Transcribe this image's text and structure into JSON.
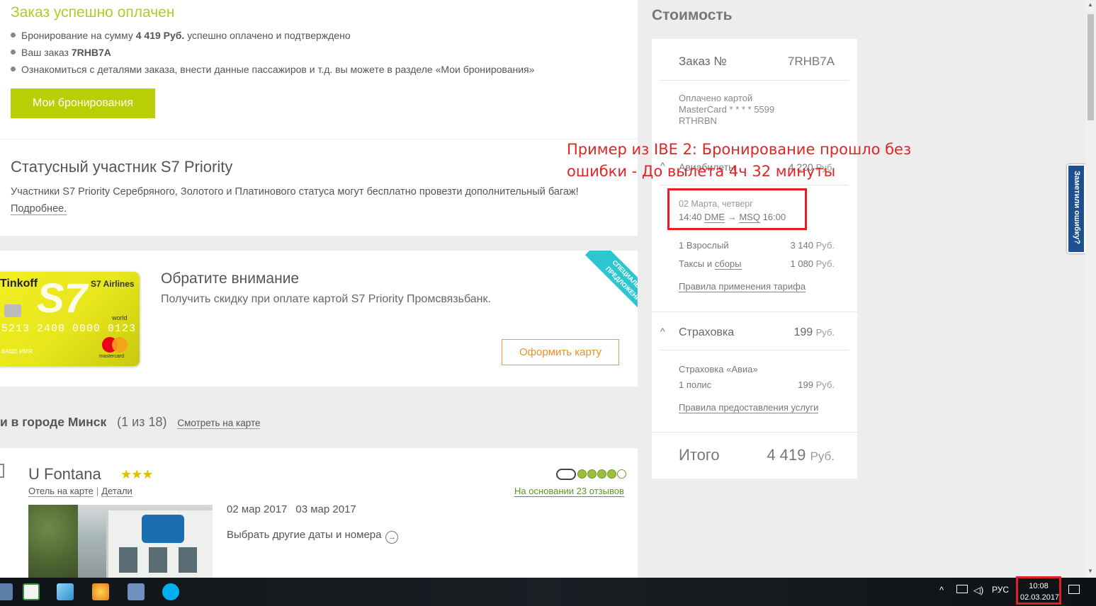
{
  "success": {
    "title": "Заказ успешно оплачен",
    "line1_pre": "Бронирование на сумму ",
    "line1_amount": "4 419 Руб.",
    "line1_post": " успешно оплачено и подтверждено",
    "line2_pre": "Ваш заказ ",
    "line2_code": "7RHB7A",
    "line3": "Ознакомиться с деталями заказа, внести данные пассажиров и т.д. вы можете в разделе «Мои бронирования»",
    "button": "Мои бронирования"
  },
  "priority": {
    "title": "Статусный участник S7 Priority",
    "text": "Участники S7 Priority Серебряного, Золотого и Платинового статуса могут бесплатно провезти дополнительный багаж!",
    "more": "Подробнее."
  },
  "promo": {
    "ribbon": "СПЕЦИАЛЬНОЕ ПРЕДЛОЖЕНИЕ",
    "title": "Обратите внимание",
    "text": "Получить скидку при оплате картой S7 Priority Промсвязьбанк.",
    "button": "Оформить карту",
    "card": {
      "bank": "Tinkoff",
      "logo": "S7",
      "airlines": "S7 Airlines",
      "world": "world",
      "number": "5213 2400 0000 0123",
      "holder": "ВАШЕ ИМЯ",
      "mc": "mastercard"
    }
  },
  "hotels": {
    "title": "и в городе Минск",
    "count": "(1 из 18)",
    "map_link": "Смотреть на карте"
  },
  "hotel": {
    "name": "U Fontana",
    "stars": "★★★",
    "map_link": "Отель на карте",
    "details_link": "Детали",
    "reviews": "На основании 23 отзывов",
    "rating": 4,
    "checkin": "02 мар 2017",
    "checkout": "03 мар 2017",
    "other_dates": "Выбрать другие даты и номера"
  },
  "cost": {
    "title": "Стоимость",
    "order_label": "Заказ №",
    "order_number": "7RHB7A",
    "paid_line1": "Оплачено картой",
    "paid_line2": "MasterCard * * * * 5599",
    "paid_line3": "RTHRBN",
    "tickets_label": "Авиабилеты",
    "tickets_value": "4 220",
    "flight_date": "02 Марта, четверг",
    "flight_dep_time": "14:40",
    "flight_from": "DME",
    "flight_to": "MSQ",
    "flight_arr_time": "16:00",
    "adult_label": "1 Взрослый",
    "adult_value": "3 140",
    "taxes_label_pre": "Таксы и ",
    "taxes_label_link": "сборы",
    "taxes_value": "1 080",
    "fare_rules": "Правила применения тарифа",
    "insurance_label": "Страховка",
    "insurance_value": "199",
    "insurance_type": "Страховка «Авиа»",
    "policy_label": "1 полис",
    "policy_value": "199",
    "service_rules": "Правила предоставления услуги",
    "total_label": "Итого",
    "total_value": "4 419",
    "currency": "Руб."
  },
  "annotation": {
    "text": "Пример из IBE 2: Бронирование прошло без ошибки - До вылета 4ч 32 минуты"
  },
  "feedback": "Заметили ошибку?",
  "taskbar": {
    "lang": "РУС",
    "time": "10:08",
    "date": "02.03.2017"
  },
  "colors": {
    "accent_green": "#b9cf05",
    "title_green": "#b5c927",
    "annotation_red": "#e22424",
    "button_orange": "#e8902a",
    "ribbon_teal": "#2dc5cf",
    "feedback_blue": "#1e4f8e"
  }
}
